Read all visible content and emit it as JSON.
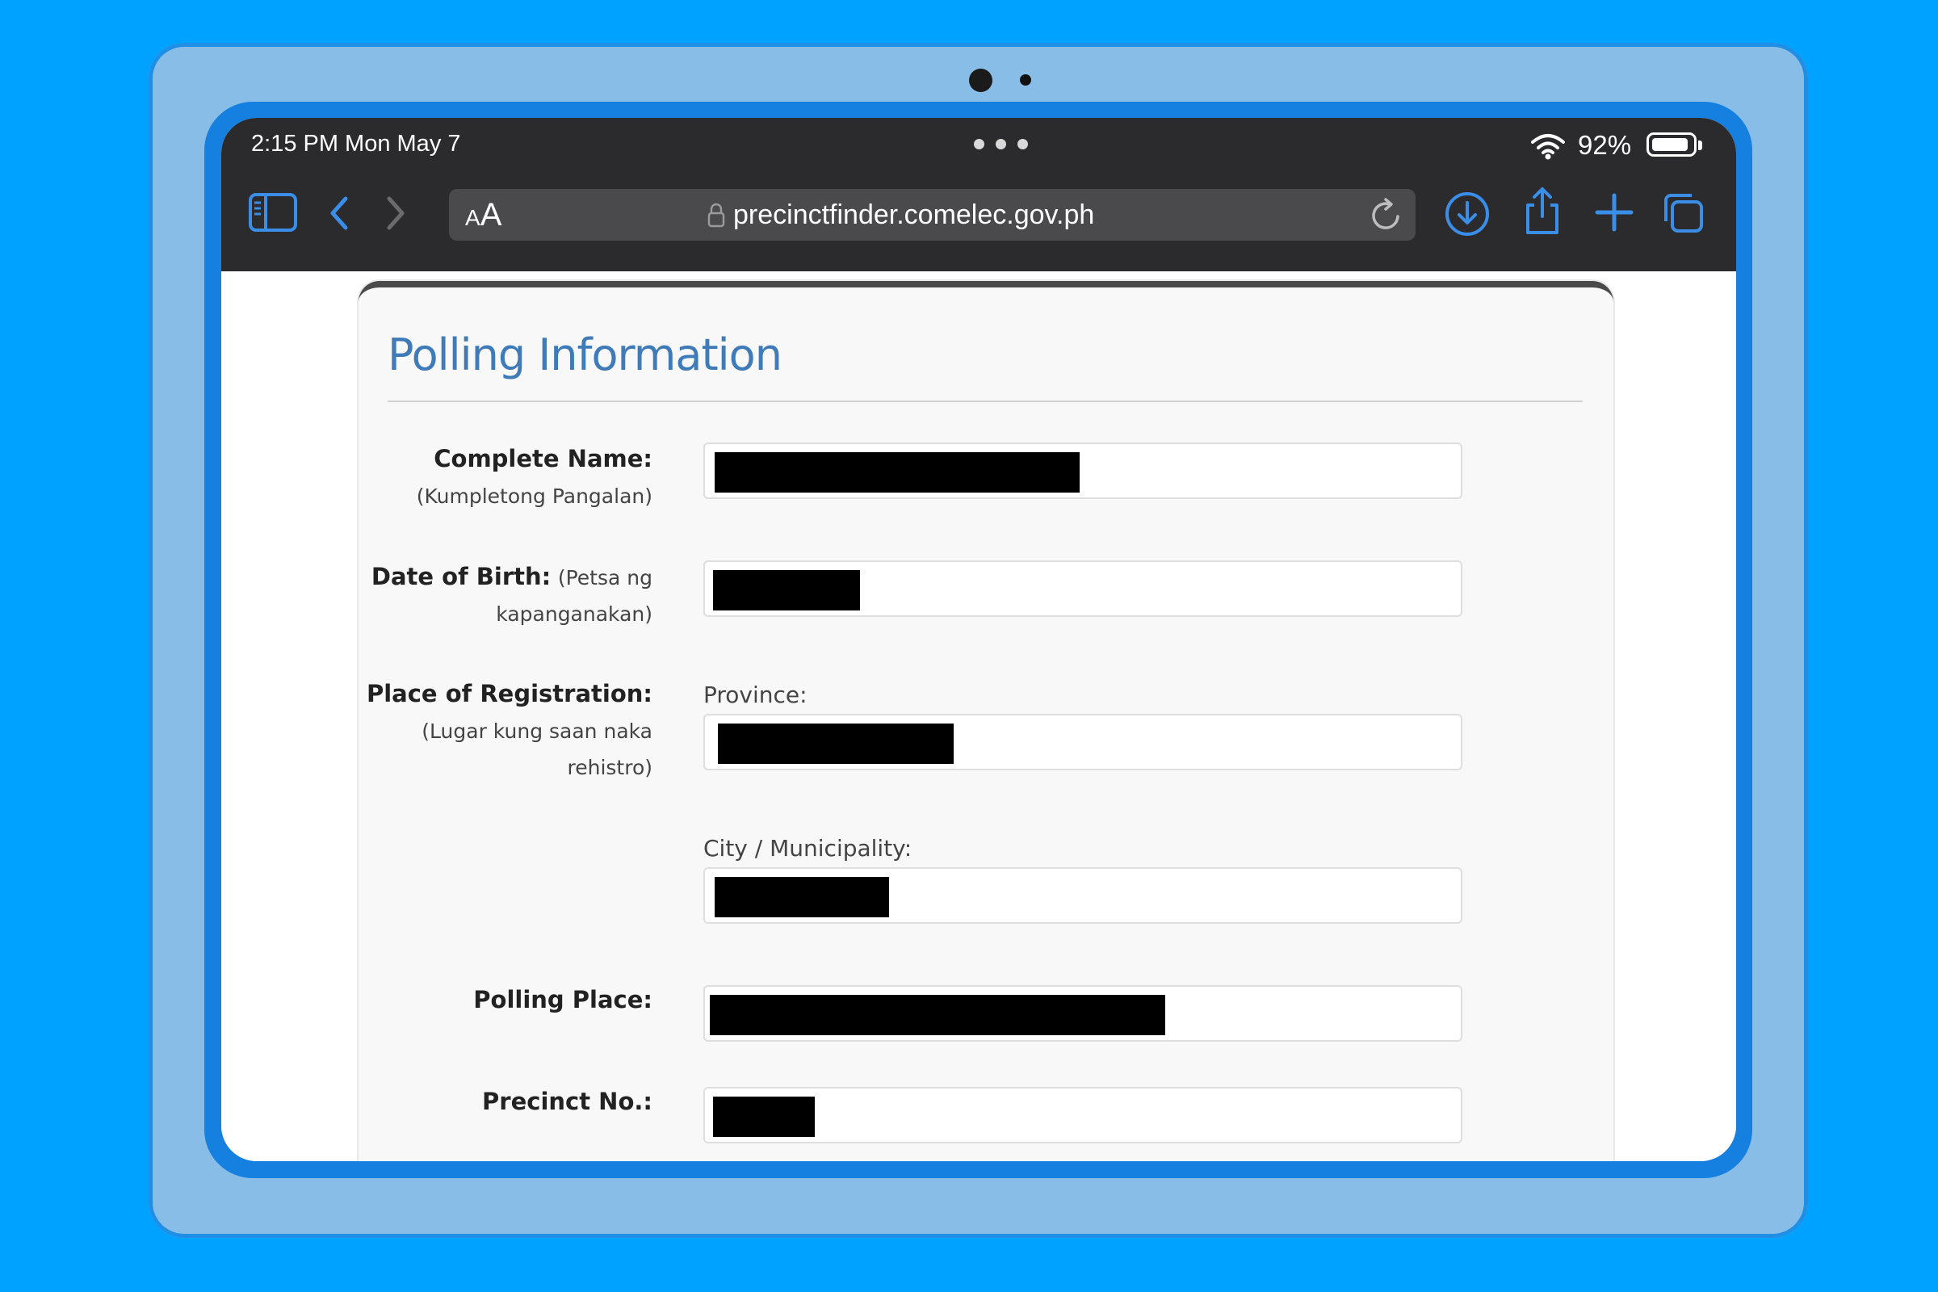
{
  "device": {
    "status_time": "2:15 PM  Mon May 7",
    "battery_percent": "92%",
    "battery_level": 0.92
  },
  "browser": {
    "text_size_small": "A",
    "text_size_large": "A",
    "url": "precinctfinder.comelec.gov.ph",
    "icons": [
      "sidebar-icon",
      "back-icon",
      "forward-icon",
      "lock-icon",
      "reload-icon",
      "download-icon",
      "share-icon",
      "new-tab-icon",
      "tabs-icon"
    ]
  },
  "page": {
    "title": "Polling Information",
    "fields": {
      "complete_name_label": "Complete Name:",
      "complete_name_sub": "(Kumpletong Pangalan)",
      "dob_label": "Date of Birth:",
      "dob_sub_1": "(Petsa ng",
      "dob_sub_2": "kapanganakan)",
      "place_label": "Place of Registration:",
      "place_sub_1": "(Lugar kung saan naka",
      "place_sub_2": "rehistro)",
      "province_caption": "Province:",
      "city_caption": "City / Municipality:",
      "polling_place_label": "Polling Place:",
      "precinct_label": "Precinct No.:"
    }
  },
  "colors": {
    "background": "#00a2ff",
    "title_blue": "#3f7bb8",
    "browser_accent": "#3a8ee8"
  }
}
